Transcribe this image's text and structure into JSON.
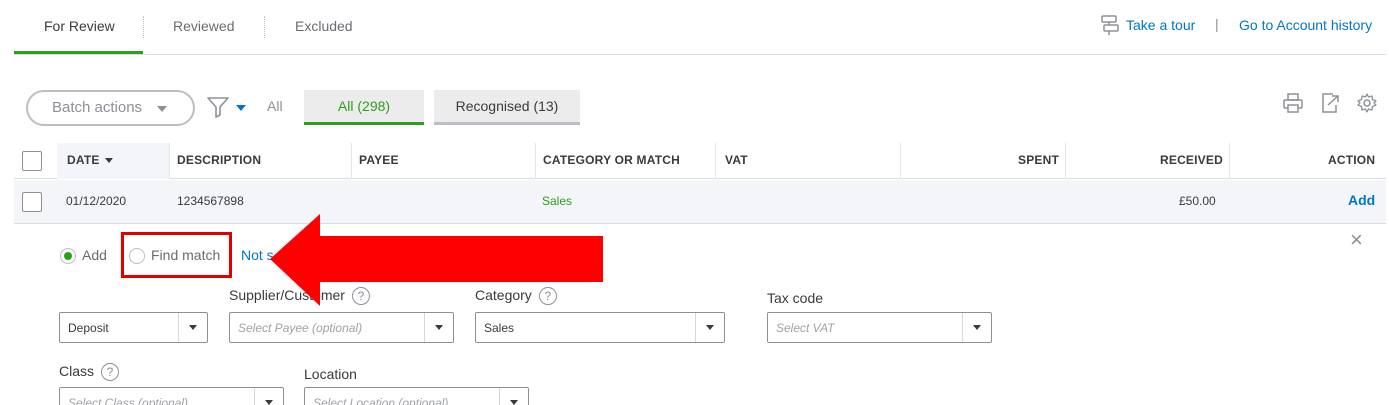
{
  "tabs": [
    {
      "label": "For Review",
      "active": true
    },
    {
      "label": "Reviewed",
      "active": false
    },
    {
      "label": "Excluded",
      "active": false
    }
  ],
  "top_links": {
    "tour_icon": "tour-signpost-icon",
    "take_tour": "Take a tour",
    "separator": "|",
    "account_history": "Go to Account history"
  },
  "toolbar": {
    "batch_actions": "Batch actions",
    "filter_icon": "filter-funnel-icon",
    "all_label": "All",
    "pill_all": "All (298)",
    "pill_recognised": "Recognised (13)",
    "icons": [
      "print-icon",
      "export-icon",
      "gear-icon"
    ]
  },
  "table": {
    "headers": {
      "date": "DATE",
      "description": "DESCRIPTION",
      "payee": "PAYEE",
      "category": "CATEGORY OR MATCH",
      "vat": "VAT",
      "spent": "SPENT",
      "received": "RECEIVED",
      "action": "ACTION"
    },
    "rows": [
      {
        "date": "01/12/2020",
        "description": "1234567898",
        "payee": "",
        "category": "Sales",
        "vat": "",
        "spent": "",
        "received": "£50.00",
        "action": "Add"
      }
    ]
  },
  "detail": {
    "radio_add": "Add",
    "radio_find_match": "Find match",
    "link_not_sure": "Not s",
    "close": "×",
    "type_select": "Deposit",
    "supplier_label": "Supplier/Customer",
    "supplier_placeholder": "Select Payee (optional)",
    "category_label": "Category",
    "category_value": "Sales",
    "tax_label": "Tax code",
    "tax_placeholder": "Select VAT",
    "class_label": "Class",
    "class_placeholder": "Select Class (optional)",
    "location_label": "Location",
    "location_placeholder": "Select Location (optional)",
    "help": "?"
  },
  "colors": {
    "accent_green": "#2ca01c",
    "link_blue": "#0077c5",
    "annotation_red": "#e10000"
  }
}
